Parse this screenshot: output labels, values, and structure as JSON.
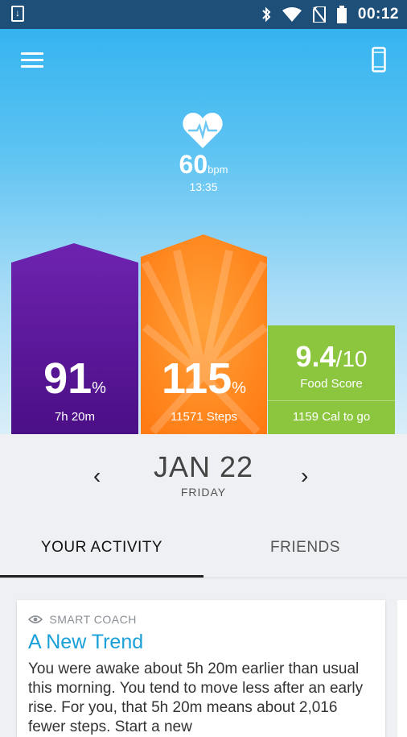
{
  "status": {
    "time": "00:12"
  },
  "heart_rate": {
    "value": "60",
    "unit": "bpm",
    "time": "13:35"
  },
  "sleep": {
    "percent": "91",
    "percent_sign": "%",
    "detail": "7h 20m",
    "color": "#6a1fa8"
  },
  "steps": {
    "percent": "115",
    "percent_sign": "%",
    "detail": "11571 Steps",
    "color": "#ff8a1e"
  },
  "food": {
    "score": "9.4",
    "score_max": "/10",
    "label": "Food Score",
    "detail": "1159 Cal to go",
    "color": "#8cc63f"
  },
  "date": {
    "prev": "‹",
    "next": "›",
    "label": "JAN 22",
    "weekday": "FRIDAY"
  },
  "tabs": {
    "activity": "YOUR ACTIVITY",
    "friends": "FRIENDS"
  },
  "card": {
    "coach_label": "SMART COACH",
    "title": "A New Trend",
    "body": "You were awake about 5h 20m earlier than usual this morning. You tend to move less after an early rise. For you, that 5h 20m means about 2,016 fewer steps. Start a new"
  }
}
